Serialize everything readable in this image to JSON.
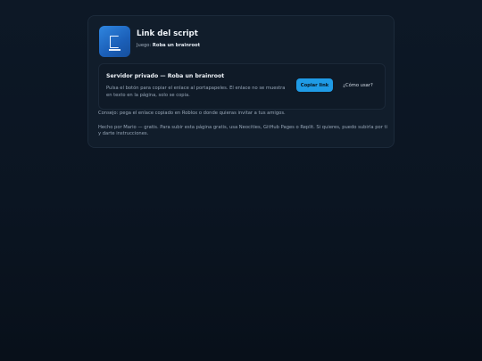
{
  "header": {
    "title": "Link del script",
    "game_label": "Juego:",
    "game_name": "Roba un brainroot"
  },
  "server_panel": {
    "title": "Servidor privado — Roba un brainroot",
    "description": "Pulsa el botón para copiar el enlace al portapapeles. El enlace no se muestra en texto en la página, solo se copia.",
    "copy_button_label": "Copiar link",
    "how_to_use_label": "¿Cómo usar?",
    "accent_color": "#1f9be6"
  },
  "tip": "Consejo: pega el enlace copiado en Roblox o donde quieras invitar a tus amigos.",
  "footer": "Hecho por Mario — gratis. Para subir esta página gratis, usa Neocities, GitHub Pages o Replit. Si quieres, puedo subirla por ti y darte instrucciones.",
  "logo": {
    "icon": "script-document-icon",
    "color": "#2f86e0"
  }
}
